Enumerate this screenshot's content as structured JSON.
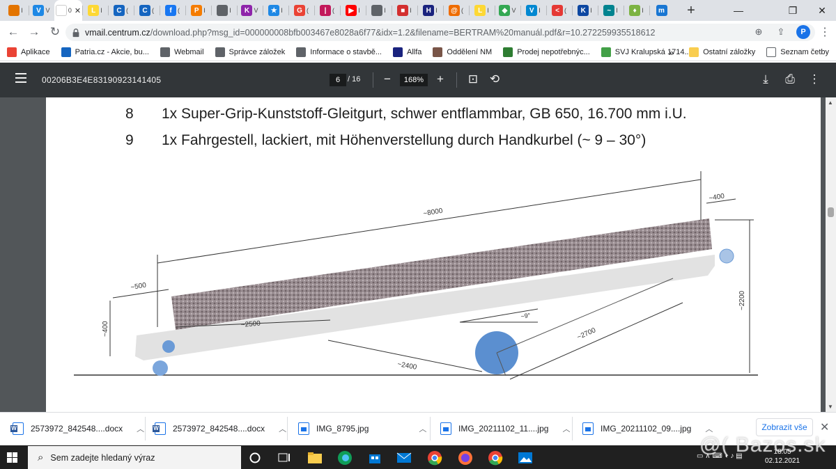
{
  "tabs": [
    {
      "label": "I",
      "color": "#e37400",
      "letter": ""
    },
    {
      "label": "V",
      "color": "#1e88e5",
      "letter": "V"
    },
    {
      "label": "0",
      "color": "#ffffff",
      "letter": "",
      "active": true
    },
    {
      "label": "I",
      "color": "#fdd835",
      "letter": "L"
    },
    {
      "label": "(",
      "color": "#1565c0",
      "letter": "C"
    },
    {
      "label": "(",
      "color": "#1565c0",
      "letter": "C"
    },
    {
      "label": "(",
      "color": "#1877f2",
      "letter": "f"
    },
    {
      "label": "I",
      "color": "#f57c00",
      "letter": "P"
    },
    {
      "label": "I",
      "color": "#5f6368",
      "letter": ""
    },
    {
      "label": "V",
      "color": "#8e24aa",
      "letter": "K"
    },
    {
      "label": "I",
      "color": "#1e88e5",
      "letter": "★"
    },
    {
      "label": "(",
      "color": "#ea4335",
      "letter": "G"
    },
    {
      "label": "(",
      "color": "#c2185b",
      "letter": "|"
    },
    {
      "label": "I",
      "color": "#ff0000",
      "letter": "▶"
    },
    {
      "label": "I",
      "color": "#5f6368",
      "letter": ""
    },
    {
      "label": "I",
      "color": "#d32f2f",
      "letter": "■"
    },
    {
      "label": "I",
      "color": "#1a237e",
      "letter": "H"
    },
    {
      "label": "(",
      "color": "#ef6c00",
      "letter": "@"
    },
    {
      "label": "I",
      "color": "#fdd835",
      "letter": "L"
    },
    {
      "label": "V",
      "color": "#34a853",
      "letter": "◆"
    },
    {
      "label": "I",
      "color": "#0288d1",
      "letter": "V"
    },
    {
      "label": "(",
      "color": "#e53935",
      "letter": "<"
    },
    {
      "label": "I",
      "color": "#0d47a1",
      "letter": "K"
    },
    {
      "label": "I",
      "color": "#00838f",
      "letter": "~"
    },
    {
      "label": "I",
      "color": "#7cb342",
      "letter": "♦"
    },
    {
      "label": "",
      "color": "#1976d2",
      "letter": "m"
    }
  ],
  "address": {
    "domain": "vmail.centrum.cz",
    "path": "/download.php?msg_id=000000008bfb003467e8028a6f77&idx=1.2&filename=BERTRAM%20manuál.pdf&r=10.272259935518612"
  },
  "bookmarks": [
    {
      "label": "Aplikace",
      "color": "#ea4335"
    },
    {
      "label": "Patria.cz - Akcie, bu...",
      "color": "#1565c0"
    },
    {
      "label": "Webmail",
      "color": "#5f6368"
    },
    {
      "label": "Správce záložek",
      "color": "#5f6368"
    },
    {
      "label": "Informace o stavbě...",
      "color": "#5f6368"
    },
    {
      "label": "Allfa",
      "color": "#1a237e"
    },
    {
      "label": "Oddělení NM",
      "color": "#795548"
    },
    {
      "label": "Prodej nepotřebnýc...",
      "color": "#2e7d32"
    },
    {
      "label": "SVJ Kralupská 1714...",
      "color": "#43a047"
    }
  ],
  "bookmarks_more": "»",
  "other_bookmarks": "Ostatní záložky",
  "reading_list": "Seznam četby",
  "pdf": {
    "title": "00206B3E4E83190923141405",
    "page": "6",
    "total": "/ 16",
    "zoom": "168%"
  },
  "document": {
    "items": [
      {
        "num": "8",
        "text": "1x Super-Grip-Kunststoff-Gleitgurt, schwer entflammbar, GB 650, 16.700 mm i.U."
      },
      {
        "num": "9",
        "text": "1x Fahrgestell, lackiert, mit Höhenverstellung durch Handkurbel (~ 9 – 30°)"
      }
    ],
    "dims": {
      "length": "~8000",
      "end": "~400",
      "start": "~500",
      "start_h": "~400",
      "belt": "~2500",
      "lower": "~2400",
      "strut": "~2700",
      "height": "~2200",
      "angle": "~9°"
    }
  },
  "downloads": [
    {
      "name": "2573972_842548....docx",
      "type": "doc"
    },
    {
      "name": "2573972_842548....docx",
      "type": "doc"
    },
    {
      "name": "IMG_8795.jpg",
      "type": "img"
    },
    {
      "name": "IMG_20211102_11....jpg",
      "type": "img"
    },
    {
      "name": "IMG_20211102_09....jpg",
      "type": "img"
    }
  ],
  "show_all": "Zobrazit vše",
  "taskbar": {
    "search_placeholder": "Sem zadejte hledaný výraz",
    "time": "18:05",
    "date": "02.12.2021"
  },
  "watermark": "@( Bazos.sk"
}
